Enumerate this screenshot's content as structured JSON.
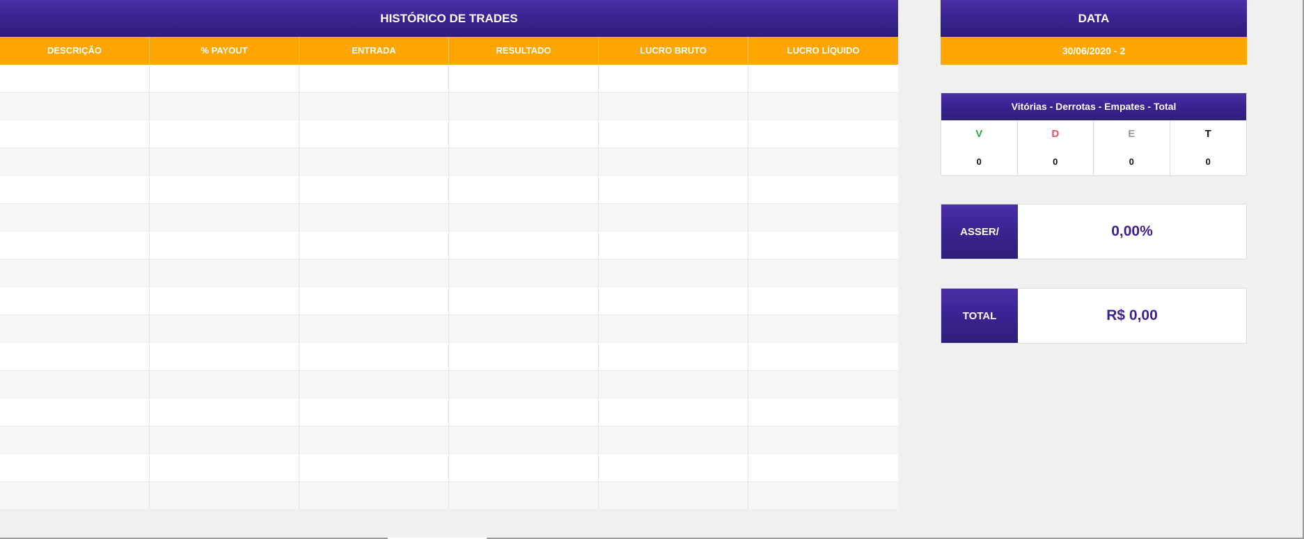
{
  "trades": {
    "title": "HISTÓRICO DE TRADES",
    "columns": [
      "DESCRIÇÃO",
      "% PAYOUT",
      "ENTRADA",
      "RESULTADO",
      "LUCRO BRUTO",
      "LUCRO LÍQUIDO"
    ],
    "rows": [
      [
        "",
        "",
        "",
        "",
        "",
        ""
      ],
      [
        "",
        "",
        "",
        "",
        "",
        ""
      ],
      [
        "",
        "",
        "",
        "",
        "",
        ""
      ],
      [
        "",
        "",
        "",
        "",
        "",
        ""
      ],
      [
        "",
        "",
        "",
        "",
        "",
        ""
      ],
      [
        "",
        "",
        "",
        "",
        "",
        ""
      ],
      [
        "",
        "",
        "",
        "",
        "",
        ""
      ],
      [
        "",
        "",
        "",
        "",
        "",
        ""
      ],
      [
        "",
        "",
        "",
        "",
        "",
        ""
      ],
      [
        "",
        "",
        "",
        "",
        "",
        ""
      ],
      [
        "",
        "",
        "",
        "",
        "",
        ""
      ],
      [
        "",
        "",
        "",
        "",
        "",
        ""
      ],
      [
        "",
        "",
        "",
        "",
        "",
        ""
      ],
      [
        "",
        "",
        "",
        "",
        "",
        ""
      ],
      [
        "",
        "",
        "",
        "",
        "",
        ""
      ],
      [
        "",
        "",
        "",
        "",
        "",
        ""
      ]
    ]
  },
  "data_panel": {
    "title": "DATA",
    "value": "30/06/2020 - 2"
  },
  "stats": {
    "title": "Vitórias - Derrotas - Empates - Total",
    "items": [
      {
        "letter": "V",
        "value": "0",
        "color": "#2aa84a"
      },
      {
        "letter": "D",
        "value": "0",
        "color": "#e8496a"
      },
      {
        "letter": "E",
        "value": "0",
        "color": "#9a9a9a"
      },
      {
        "letter": "T",
        "value": "0",
        "color": "#111111"
      }
    ]
  },
  "assertiveness": {
    "label": "ASSER/",
    "value": "0,00%"
  },
  "total": {
    "label": "TOTAL",
    "value": "R$ 0,00"
  },
  "colors": {
    "header_purple": "#3b2493",
    "header_orange": "#ffa500",
    "value_purple": "#3f1e91"
  }
}
